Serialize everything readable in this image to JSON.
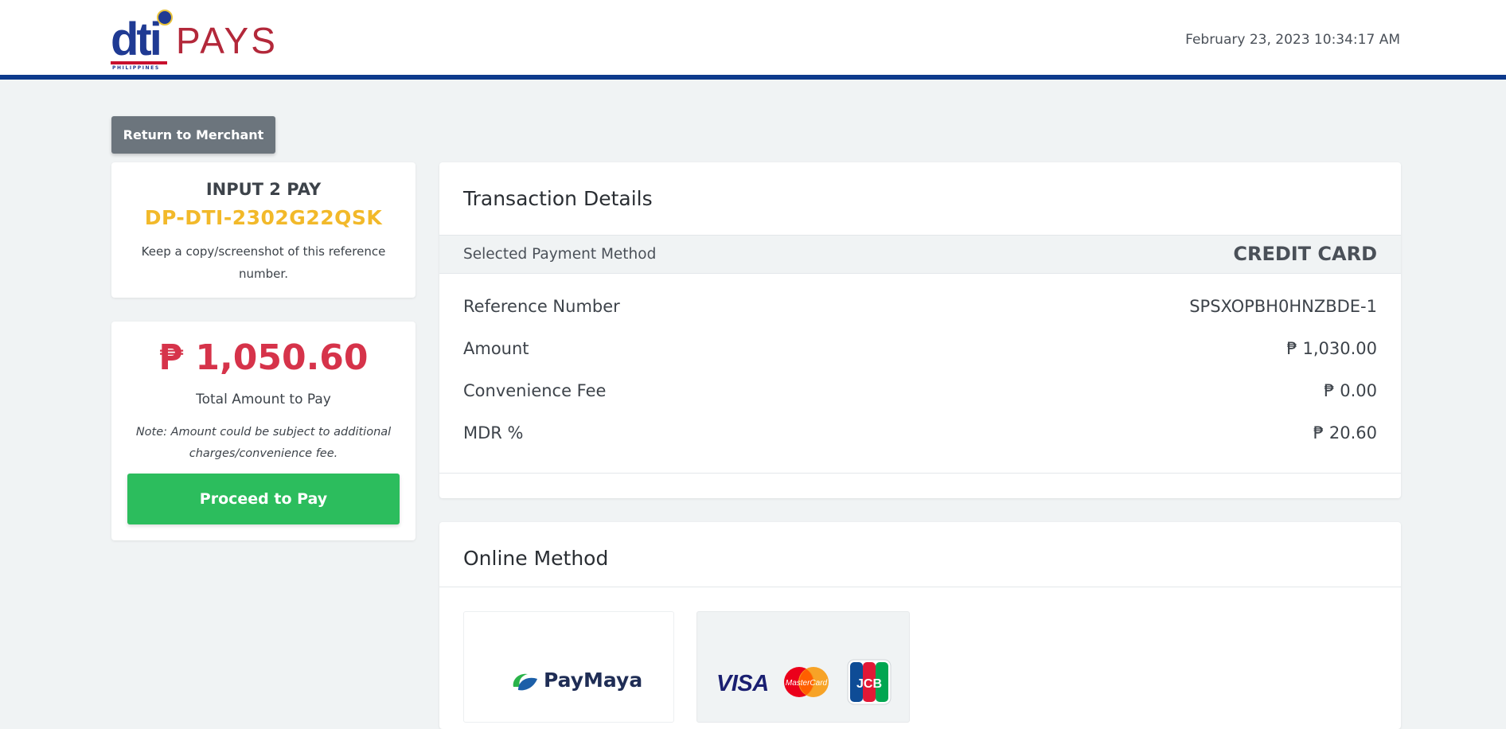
{
  "header": {
    "logo_text_primary": "dti",
    "logo_text_secondary": "PAYS",
    "logo_subtext": "PHILIPPINES",
    "datetime": "February 23, 2023 10:34:17 AM"
  },
  "return_button": {
    "label": "Return to Merchant"
  },
  "reference_card": {
    "title": "INPUT 2 PAY",
    "code": "DP-DTI-2302G22QSK",
    "note": "Keep a copy/screenshot of this reference number."
  },
  "total_card": {
    "amount": "₱ 1,050.60",
    "label": "Total Amount to Pay",
    "note": "Note: Amount could be subject to additional charges/convenience fee.",
    "proceed_label": "Proceed to Pay"
  },
  "transaction": {
    "title": "Transaction Details",
    "method_label": "Selected Payment Method",
    "method_value": "CREDIT CARD",
    "rows": [
      {
        "label": "Reference Number",
        "value": "SPSXOPBH0HNZBDE-1"
      },
      {
        "label": "Amount",
        "value": "₱ 1,030.00"
      },
      {
        "label": "Convenience Fee",
        "value": "₱ 0.00"
      },
      {
        "label": "MDR %",
        "value": "₱ 20.60"
      }
    ]
  },
  "online_method": {
    "title": "Online Method",
    "options": [
      {
        "name": "PayMaya"
      },
      {
        "visa": "VISA",
        "mastercard": "MasterCard",
        "jcb": "JCB"
      }
    ]
  },
  "colors": {
    "header_bar": "#0d3a8c",
    "accent_yellow": "#f2b92a",
    "amount_red": "#d6334a",
    "proceed_green": "#2cbd5d",
    "return_gray": "#6c757d"
  }
}
